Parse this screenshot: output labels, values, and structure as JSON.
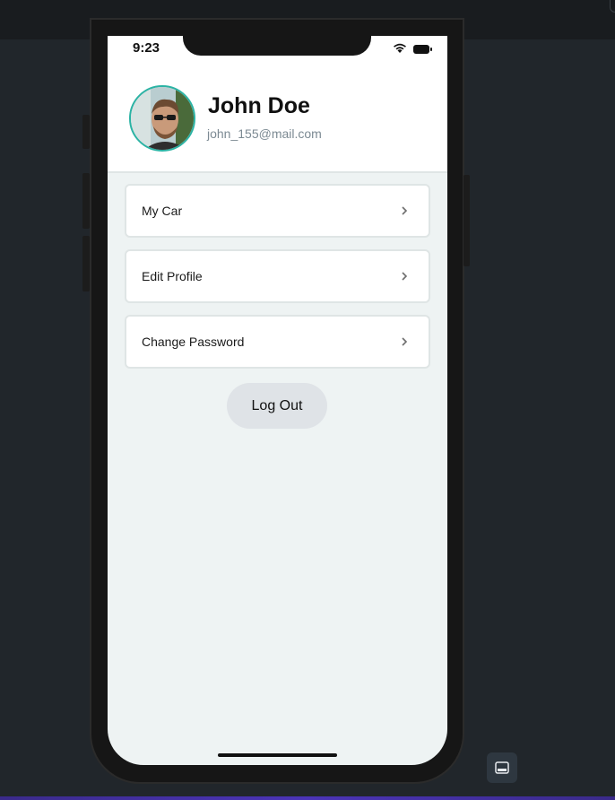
{
  "status_bar": {
    "time": "9:23",
    "icons": [
      "wifi-icon",
      "battery-icon"
    ]
  },
  "profile": {
    "name": "John Doe",
    "email": "john_155@mail.com",
    "avatar": "profile-photo"
  },
  "menu": {
    "items": [
      {
        "label": "My Car",
        "icon": "chevron-right-icon"
      },
      {
        "label": "Edit Profile",
        "icon": "chevron-right-icon"
      },
      {
        "label": "Change Password",
        "icon": "chevron-right-icon"
      }
    ]
  },
  "actions": {
    "logout_label": "Log Out"
  },
  "colors": {
    "accent_ring": "#2bb3a4",
    "screen_bg": "#eef3f3",
    "logout_bg": "#dfe3e7",
    "desktop_bg": "#21262b"
  },
  "toolbar": {
    "panel_toggle_icon": "panel-bottom-icon"
  }
}
